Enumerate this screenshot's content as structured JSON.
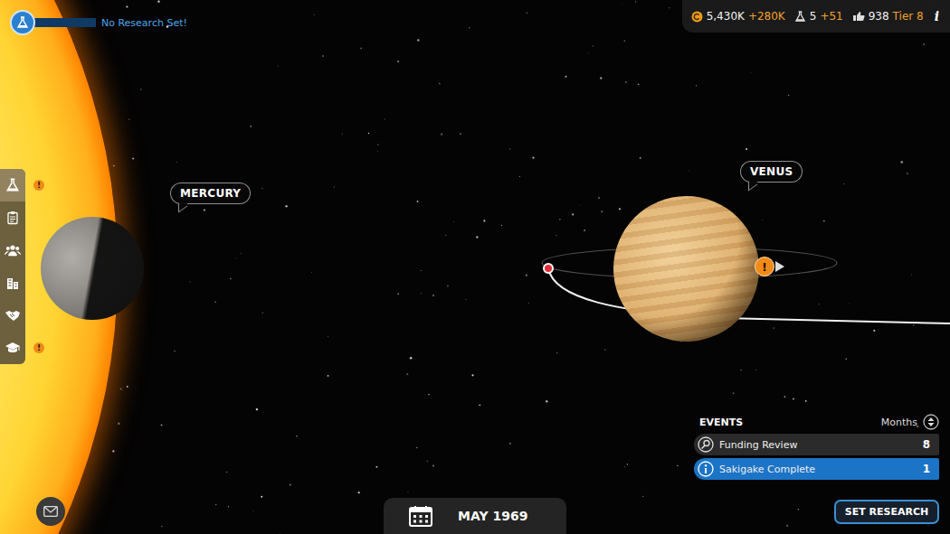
{
  "research_status": {
    "text": "No Research Set!",
    "level": 0
  },
  "resources": {
    "money": "5,430K",
    "money_delta": "+280K",
    "science": "5",
    "science_delta": "+51",
    "support": "938",
    "tier": "Tier 8",
    "info": "i"
  },
  "sidebar": {
    "items": [
      {
        "kind": "research",
        "badge": "!",
        "selected": true
      },
      {
        "kind": "missions",
        "badge": "",
        "selected": false
      },
      {
        "kind": "staff",
        "badge": "",
        "selected": false
      },
      {
        "kind": "buildings",
        "badge": "",
        "selected": false
      },
      {
        "kind": "agreements",
        "badge": "",
        "selected": false
      },
      {
        "kind": "education",
        "badge": "!",
        "selected": false
      }
    ]
  },
  "planets": [
    {
      "name": "MERCURY"
    },
    {
      "name": "VENUS"
    }
  ],
  "mission_marker": {
    "badge": "!"
  },
  "events": {
    "title": "EVENTS",
    "unit": "Months",
    "rows": [
      {
        "kind": "review",
        "name": "Funding Review",
        "months": "8",
        "selected": false
      },
      {
        "kind": "info",
        "name": "Sakigake Complete",
        "months": "1",
        "selected": true
      }
    ]
  },
  "date": "MAY 1969",
  "button": "SET RESEARCH"
}
